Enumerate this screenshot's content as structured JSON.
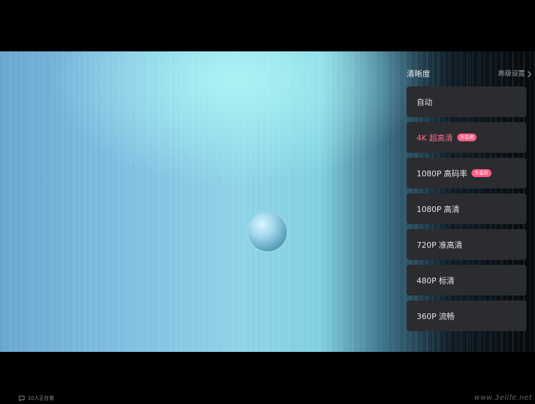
{
  "panel": {
    "title": "清晰度",
    "advanced_label": "高级设置"
  },
  "options": [
    {
      "label": "自动",
      "badge": "",
      "selected": false
    },
    {
      "label": "4K 超高清",
      "badge": "大会员",
      "selected": true
    },
    {
      "label": "1080P 高码率",
      "badge": "大会员",
      "selected": false
    },
    {
      "label": "1080P 高清",
      "badge": "",
      "selected": false
    },
    {
      "label": "720P 准高清",
      "badge": "",
      "selected": false
    },
    {
      "label": "480P 标清",
      "badge": "",
      "selected": false
    },
    {
      "label": "360P 流畅",
      "badge": "",
      "selected": false
    }
  ],
  "footer": {
    "viewers": "10人正在看"
  },
  "watermark": "www.3elife.net",
  "colors": {
    "accent": "#ff6c8f",
    "badge_bg": "#ff5d86",
    "option_bg": "#2a2c2f"
  },
  "icons": {
    "advanced": "chevron-right-icon",
    "viewers": "viewers-icon"
  }
}
